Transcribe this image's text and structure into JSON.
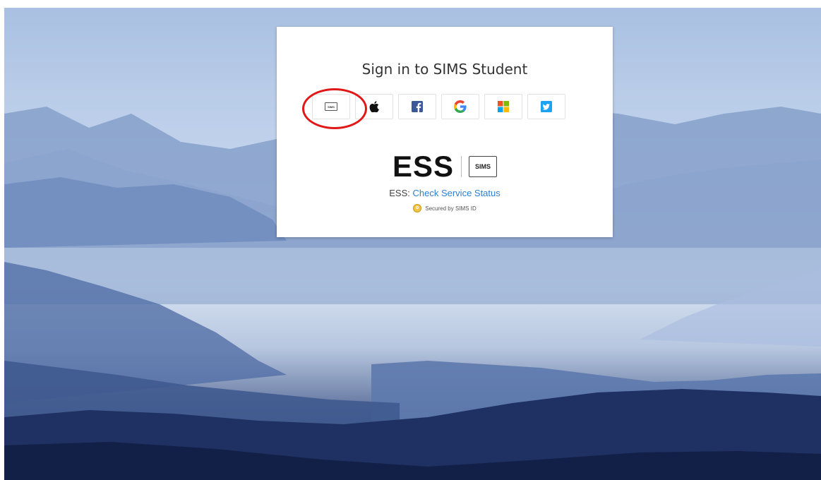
{
  "login": {
    "title": "Sign in to SIMS Student",
    "providers": [
      {
        "name": "SIMS",
        "icon": "sims-icon"
      },
      {
        "name": "Apple",
        "icon": "apple-icon"
      },
      {
        "name": "Facebook",
        "icon": "facebook-icon"
      },
      {
        "name": "Google",
        "icon": "google-icon"
      },
      {
        "name": "Microsoft",
        "icon": "microsoft-icon"
      },
      {
        "name": "Twitter",
        "icon": "twitter-icon"
      }
    ],
    "sims_button_text": "SIMS",
    "brand_word": "ESS",
    "brand_badge": "SIMS",
    "status_prefix": "ESS:",
    "status_link": "Check Service Status",
    "secured_text": "Secured by SIMS ID"
  },
  "colors": {
    "link": "#2c7fd1",
    "highlight": "#e01818",
    "facebook": "#3b5998",
    "twitter": "#1da1f2"
  }
}
